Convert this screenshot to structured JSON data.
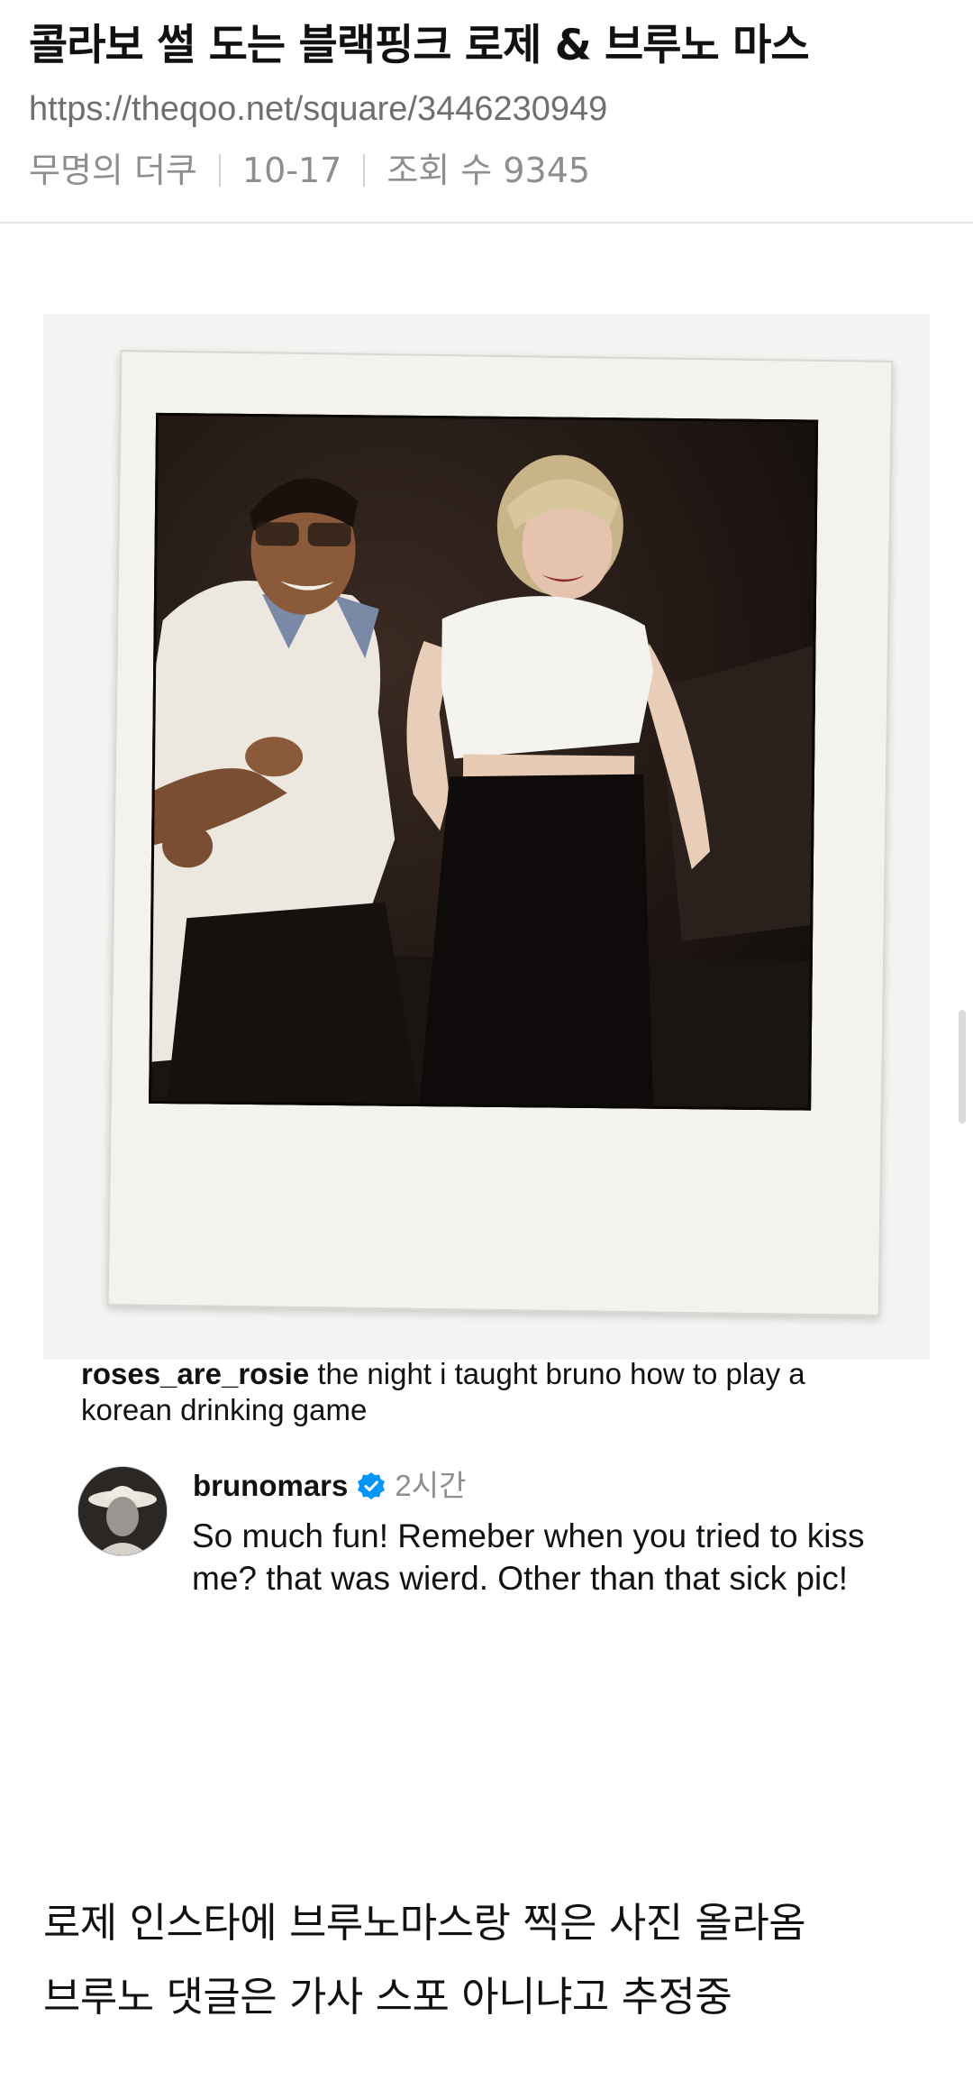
{
  "post": {
    "title": "콜라보 썰 도는 블랙핑크 로제 & 브루노 마스",
    "url": "https://theqoo.net/square/3446230949",
    "author": "무명의 더쿠",
    "date": "10-17",
    "views_label": "조회 수 9345"
  },
  "embed": {
    "caption_user": "roses_are_rosie",
    "caption_text": " the night i taught bruno how to play a korean drinking game",
    "comment": {
      "user": "brunomars",
      "verified_icon": "verified-badge-icon",
      "time": "2시간",
      "text": "So much fun! Remeber when you tried to kiss me? that was wierd. Other than that sick pic!"
    }
  },
  "body": {
    "lines": [
      "로제 인스타에 브루노마스랑 찍은 사진 올라옴",
      "브루노 댓글은 가사 스포 아니냐고 추정중"
    ]
  },
  "colors": {
    "text": "#111111",
    "meta": "#8e8e8e",
    "verified": "#0095f6"
  }
}
